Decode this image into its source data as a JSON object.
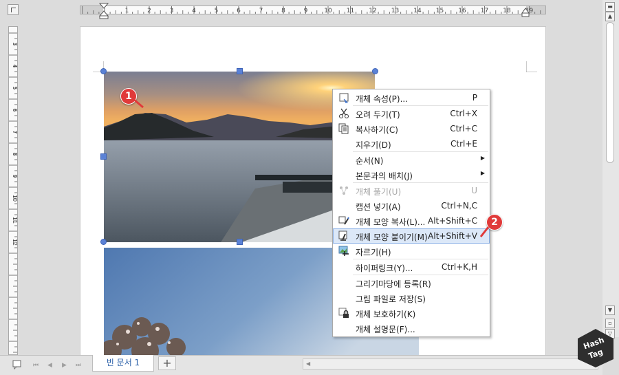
{
  "ruler": {
    "h_numbers": [
      "1",
      "2",
      "3",
      "4",
      "5",
      "6",
      "7",
      "8",
      "9",
      "10",
      "11",
      "12",
      "13",
      "14",
      "15",
      "16",
      "17",
      "18",
      "19"
    ],
    "v_numbers": [
      "3",
      "4",
      "5",
      "6",
      "7",
      "8",
      "9",
      "10",
      "11",
      "12"
    ]
  },
  "context_menu": {
    "items": [
      {
        "label": "개체 속성(P)...",
        "shortcut": "P",
        "icon": "properties-icon"
      },
      {
        "label": "오려 두기(T)",
        "shortcut": "Ctrl+X",
        "icon": "scissors-icon"
      },
      {
        "label": "복사하기(C)",
        "shortcut": "Ctrl+C",
        "icon": "copy-icon"
      },
      {
        "label": "지우기(D)",
        "shortcut": "Ctrl+E"
      },
      {
        "label": "순서(N)",
        "submenu": true
      },
      {
        "label": "본문과의 배치(J)",
        "submenu": true
      },
      {
        "label": "개체 풀기(U)",
        "shortcut": "U",
        "disabled": true,
        "icon": "ungroup-icon"
      },
      {
        "label": "캡션 넣기(A)",
        "shortcut": "Ctrl+N,C"
      },
      {
        "label": "개체 모양 복사(L)...",
        "shortcut": "Alt+Shift+C",
        "icon": "copy-format-icon"
      },
      {
        "label": "개체 모양 붙이기(M)",
        "shortcut": "Alt+Shift+V",
        "icon": "paste-format-icon",
        "highlighted": true
      },
      {
        "label": "자르기(H)",
        "icon": "crop-icon"
      },
      {
        "label": "하이퍼링크(Y)...",
        "shortcut": "Ctrl+K,H"
      },
      {
        "label": "그리기마당에 등록(R)"
      },
      {
        "label": "그림 파일로 저장(S)"
      },
      {
        "label": "개체 보호하기(K)",
        "icon": "lock-icon"
      },
      {
        "label": "개체 설명문(F)..."
      }
    ]
  },
  "badges": {
    "one": "1",
    "two": "2"
  },
  "tabs": {
    "document_tab": "빈 문서 1",
    "add_tab": "+"
  },
  "watermark": {
    "line1": "Hash",
    "line2": "Tag"
  },
  "colors": {
    "selection_handle": "#5b82d6",
    "badge": "#e03a3a",
    "highlight": "#dce8f8"
  }
}
